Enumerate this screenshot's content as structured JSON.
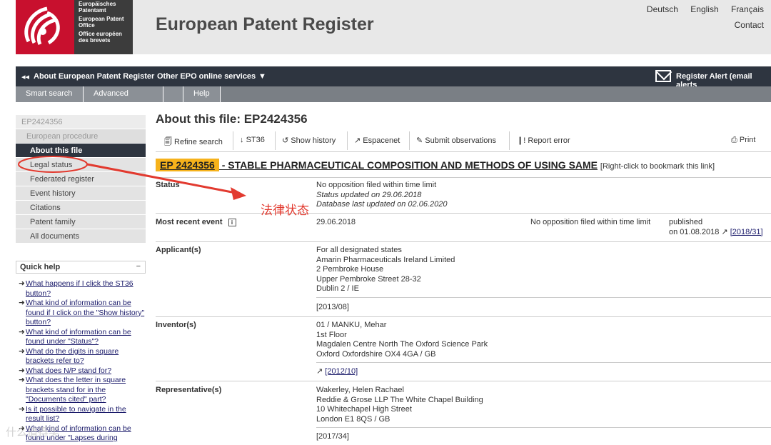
{
  "header": {
    "logo_lines": [
      "Europäisches Patentamt",
      "European Patent Office",
      "Office européen des brevets"
    ],
    "title": "European Patent Register",
    "languages": [
      "Deutsch",
      "English",
      "Français"
    ],
    "contact": "Contact"
  },
  "topnav": {
    "about": "About European Patent Register",
    "other": "Other EPO online services",
    "alert": "Register Alert (email alerts"
  },
  "tabs": [
    "Smart search",
    "Advanced search",
    "Help"
  ],
  "sidebar": {
    "file_id": "EP2424356",
    "procedure": "European procedure",
    "items": [
      "About this file",
      "Legal status",
      "Federated register",
      "Event history",
      "Citations",
      "Patent family",
      "All documents"
    ]
  },
  "quickhelp": {
    "title": "Quick help",
    "toggle": "−",
    "links": [
      "What happens if I click the ST36 button?",
      "What kind of information can be found if I click on the \"Show history\" button?",
      "What kind of information can be found under \"Status\"?",
      "What do the digits in square brackets refer to?",
      "What does N/P stand for?",
      "What does the letter in square brackets stand for in the \"Documents cited\" part?",
      "Is it possible to navigate in the result list?",
      "What kind of information can be found under \"Lapses during"
    ]
  },
  "main": {
    "title": "About this file: EP2424356",
    "toolbar": [
      "Refine search",
      "ST36",
      "Show history",
      "Espacenet",
      "Submit observations",
      "Report error",
      "Print"
    ],
    "ep_number": "EP 2424356",
    "ep_title": " - STABLE PHARMACEUTICAL COMPOSITION AND METHODS OF USING SAME",
    "bookmark": "[Right-click to bookmark this link]"
  },
  "status": {
    "label": "Status",
    "line1": "No opposition filed within time limit",
    "line2": "Status updated on  29.06.2018",
    "line3": "Database last updated on 02.06.2020"
  },
  "event": {
    "label": "Most recent event",
    "info": "i",
    "date": "29.06.2018",
    "description": "No opposition filed within time limit",
    "published": "published",
    "published_on": "on 01.08.2018",
    "ref": "[2018/31]"
  },
  "applicant": {
    "label": "Applicant(s)",
    "lines": [
      "For all designated states",
      "Amarin Pharmaceuticals Ireland Limited",
      "2 Pembroke House",
      "Upper Pembroke Street 28-32",
      "Dublin 2 / IE"
    ],
    "ref": "[2013/08]"
  },
  "inventor": {
    "label": "Inventor(s)",
    "lines": [
      "01 / MANKU, Mehar",
      "1st Floor",
      "Magdalen Centre North The Oxford Science Park",
      "Oxford Oxfordshire OX4 4GA / GB"
    ],
    "ref": "[2012/10]"
  },
  "representative": {
    "label": "Representative(s)",
    "lines": [
      "Wakerley, Helen Rachael",
      "Reddie & Grose LLP The White Chapel Building",
      "10 Whitechapel High Street",
      "London E1 8QS / GB"
    ],
    "ref": "[2017/34]"
  },
  "annotation": {
    "text": "法律状态",
    "color": "#e23a2f"
  },
  "watermark": "什么值得买"
}
